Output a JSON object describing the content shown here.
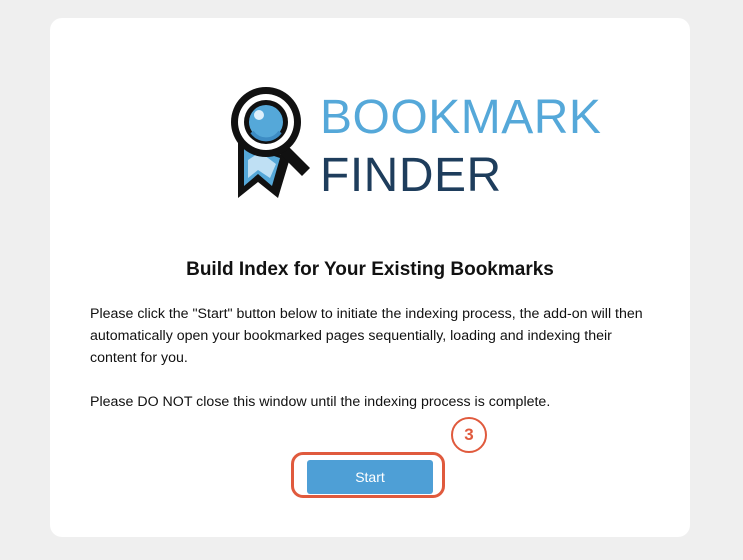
{
  "logo": {
    "line1": "BOOKMARK",
    "line2": "FINDER",
    "icon": "magnifier-ribbon-icon"
  },
  "heading": "Build Index for Your Existing Bookmarks",
  "instructions": {
    "paragraph1": "Please click the \"Start\" button below to initiate the indexing process, the add-on will then automatically open your bookmarked pages sequentially, loading and indexing their content for you.",
    "paragraph2": "Please DO NOT close this window until the indexing process is complete."
  },
  "start_button": {
    "label": "Start"
  },
  "annotation": {
    "step_number": "3"
  },
  "colors": {
    "accent": "#4e9fd6",
    "logo_light": "#55a8d9",
    "logo_dark": "#1e3d5c",
    "highlight": "#e05a3d",
    "background": "#efefef"
  }
}
